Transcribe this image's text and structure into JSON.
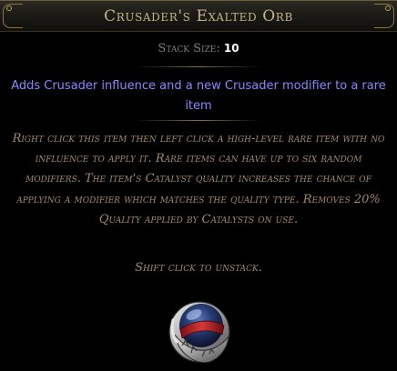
{
  "item": {
    "name": "Crusader's Exalted Orb",
    "stack_size_label": "Stack Size:",
    "stack_size_value": "10",
    "explicit_mod": "Adds Crusader influence and a new Crusader modifier to a rare item",
    "description": "Right click this item then left click a high-level rare item with no influence to apply it. Rare items can have up to six random modifiers. The item's Catalyst quality increases the chance of applying a modifier which matches the quality type. Removes 20% Quality applied by Catalysts on use.",
    "hint": "Shift click to unstack.",
    "icon": "crusaders-exalted-orb-icon"
  },
  "colors": {
    "title": "#c7b487",
    "label": "#7f7f7f",
    "value": "#ffffff",
    "explicit_mod": "#8888ff",
    "flavour": "#a3896a",
    "separator": "#8b6f3d"
  }
}
